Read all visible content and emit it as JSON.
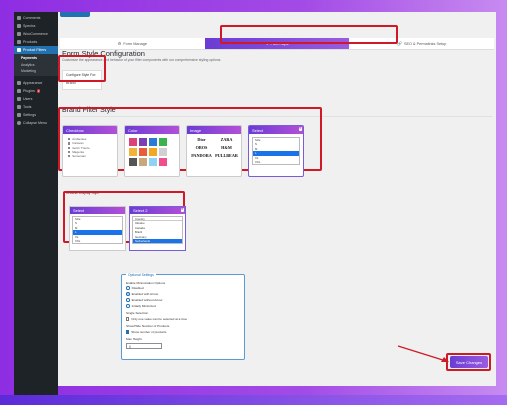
{
  "sidebar": {
    "items": [
      {
        "label": "Comments"
      },
      {
        "label": "Spectra"
      },
      {
        "label": "WooCommerce"
      },
      {
        "label": "Products"
      },
      {
        "label": "Product Filters"
      },
      {
        "label": "Appearance"
      },
      {
        "label": "Plugins",
        "badge": "2"
      },
      {
        "label": "Users"
      },
      {
        "label": "Tools"
      },
      {
        "label": "Settings"
      },
      {
        "label": "Collapse Menu"
      }
    ],
    "sub_items": [
      {
        "label": "Payments"
      },
      {
        "label": "Analytics"
      },
      {
        "label": "Marketing"
      }
    ]
  },
  "tabs": [
    {
      "label": "Form Manage",
      "icon": "⚙"
    },
    {
      "label": "Form Style",
      "icon": "✎"
    },
    {
      "label": "SEO & Permalinks Setup",
      "icon": "🔗"
    }
  ],
  "page": {
    "title": "Form Style Configuration",
    "description": "Customize the appearance and behavior of your filter components with our comprehensive styling options."
  },
  "configure_card": {
    "title": "Configure Style For:",
    "value": "Brand"
  },
  "section_title": "Brand Filter Style",
  "styles": {
    "checkbox": {
      "title": "Checkbox",
      "items": [
        "Ambientes",
        "Caravan",
        "Gold / Trento",
        "Magenta",
        "Sememan"
      ]
    },
    "color": {
      "title": "Color",
      "swatches": [
        "#d9437a",
        "#7a3fb0",
        "#2a7bd4",
        "#3cb34a",
        "#f0b43c",
        "#e85c3a",
        "#f5a623",
        "#d0d0d0",
        "#555555",
        "#c9a87c",
        "#8fd3f4",
        "#f04e8c"
      ]
    },
    "image": {
      "title": "Image",
      "logos": [
        "Dior",
        "ZARA",
        "OBOS",
        "H&M",
        "PANDORA",
        "PULLBEAR"
      ]
    },
    "select": {
      "title": "Select",
      "options": [
        "Size",
        "S",
        "M",
        "L",
        "XL",
        "XXL"
      ],
      "selected_index": 3
    }
  },
  "display_style": {
    "label": "Choose Display Style *",
    "select": {
      "title": "Select",
      "options": [
        "Size",
        "S",
        "M",
        "L",
        "XL",
        "XXL"
      ],
      "selected_index": 3
    },
    "select2": {
      "title": "Select 2",
      "search_value": "Country",
      "options": [
        "Ukraine",
        "Canada",
        "Brazil",
        "Germany",
        "Netherlands"
      ],
      "selected_index": 4
    }
  },
  "options": {
    "legend": "Optional Settings",
    "animation_label": "Enable Minimization Options",
    "radios": [
      {
        "label": "Disabled",
        "checked": false
      },
      {
        "label": "Enabled with Arrow",
        "checked": true
      },
      {
        "label": "Enabled without Arrow",
        "checked": false
      },
      {
        "label": "Initially Minimized",
        "checked": false
      }
    ],
    "single_selection_label": "Single Selection",
    "single_selection_text": "Only one value can be selected at a time",
    "show_count_label": "Show/Hide Number of Products",
    "show_count_text": "Show number of products",
    "max_height_label": "Max Height",
    "max_height_value": "0"
  },
  "save_button": "Save Changes"
}
